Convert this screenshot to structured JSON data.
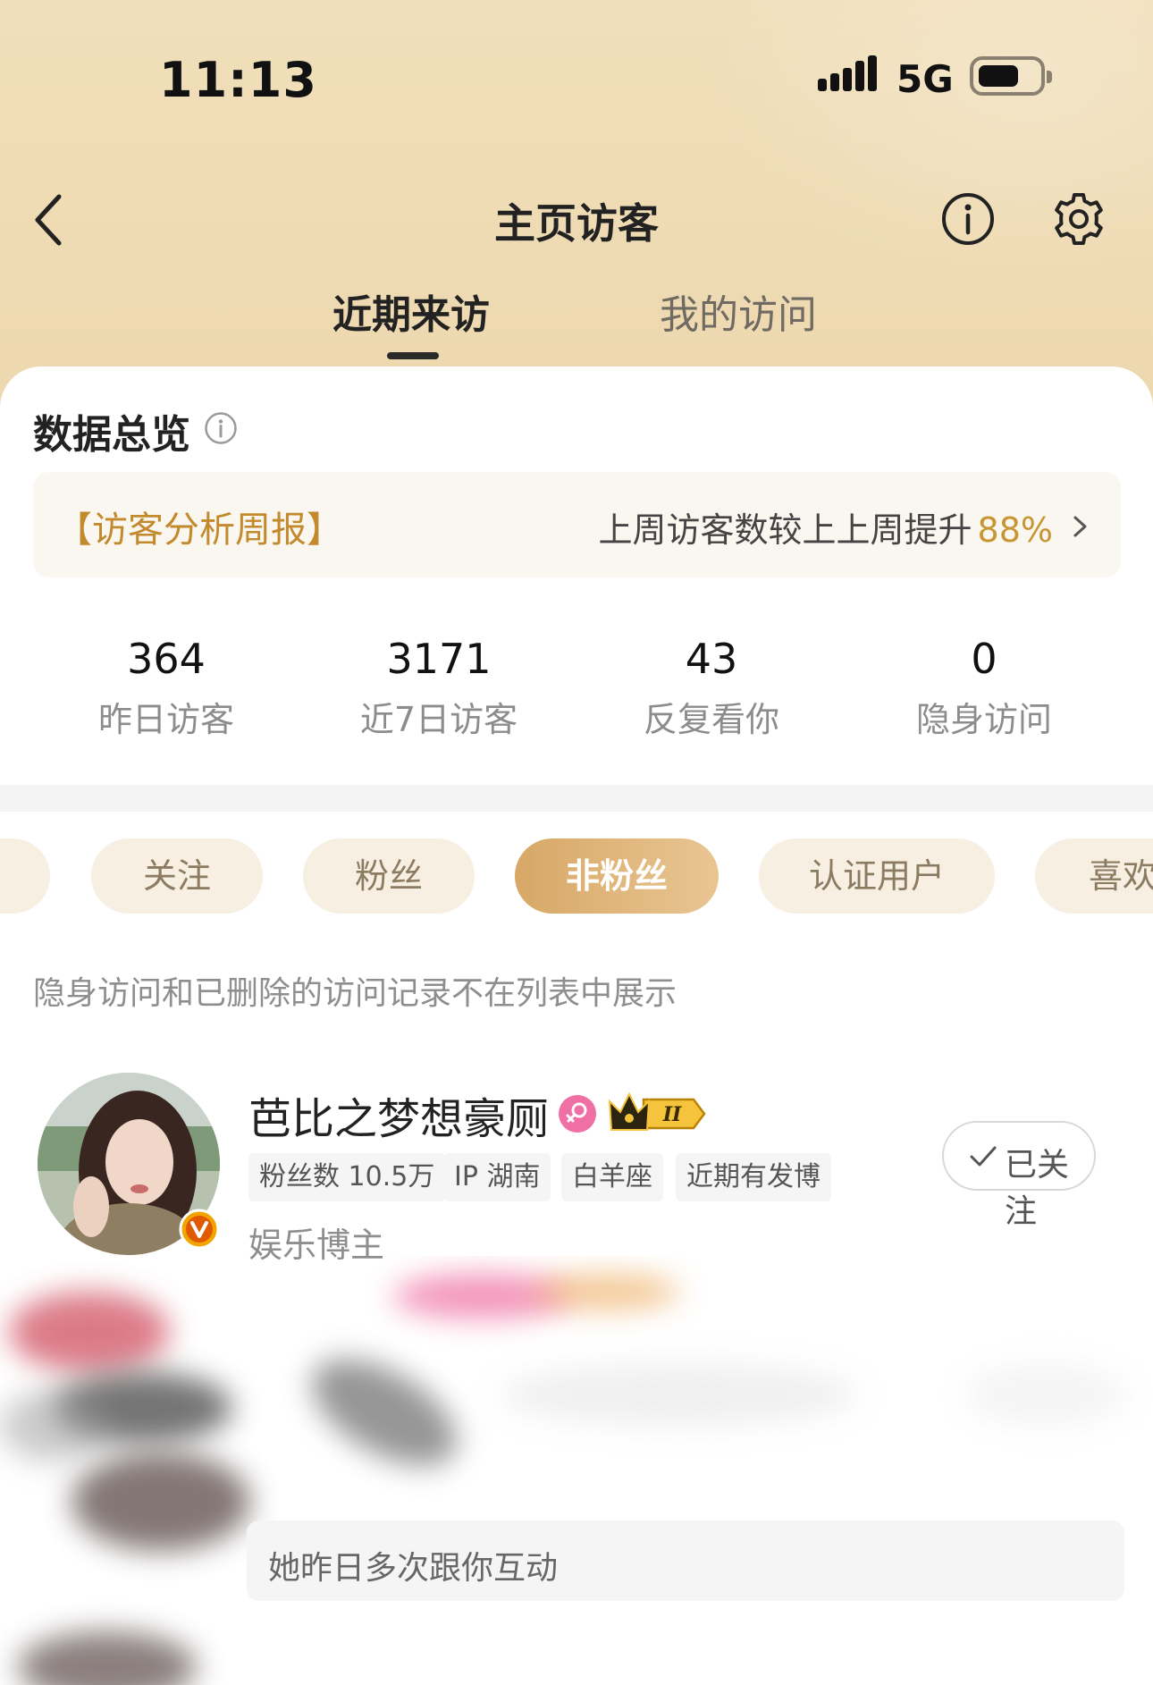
{
  "status_bar": {
    "time": "11:13",
    "network": "5G"
  },
  "nav": {
    "title": "主页访客"
  },
  "tabs": [
    {
      "label": "近期来访",
      "active": true
    },
    {
      "label": "我的访问",
      "active": false
    }
  ],
  "overview": {
    "title": "数据总览",
    "banner": {
      "label": "【访客分析周报】",
      "text": "上周访客数较上上周提升",
      "percent": "88%"
    },
    "stats": [
      {
        "value": "364",
        "label": "昨日访客"
      },
      {
        "value": "3171",
        "label": "近7日访客"
      },
      {
        "value": "43",
        "label": "反复看你"
      },
      {
        "value": "0",
        "label": "隐身访问"
      }
    ]
  },
  "filters": [
    {
      "label": "关注",
      "active": false
    },
    {
      "label": "粉丝",
      "active": false
    },
    {
      "label": "非粉丝",
      "active": true
    },
    {
      "label": "认证用户",
      "active": false
    },
    {
      "label": "喜欢",
      "active": false
    }
  ],
  "notice": "隐身访问和已删除的访问记录不在列表中展示",
  "visitors": [
    {
      "name": "芭比之梦想豪厕",
      "tags": [
        "粉丝数 10.5万",
        "IP 湖南",
        "白羊座",
        "近期有发博"
      ],
      "role": "娱乐博主",
      "follow_label": "已关注",
      "level": "II"
    }
  ],
  "interaction_hint": "她昨日多次跟你互动",
  "colors": {
    "accent": "#c38a2d",
    "chip_active": "#d7a867",
    "header_bg": "#eedab2"
  }
}
